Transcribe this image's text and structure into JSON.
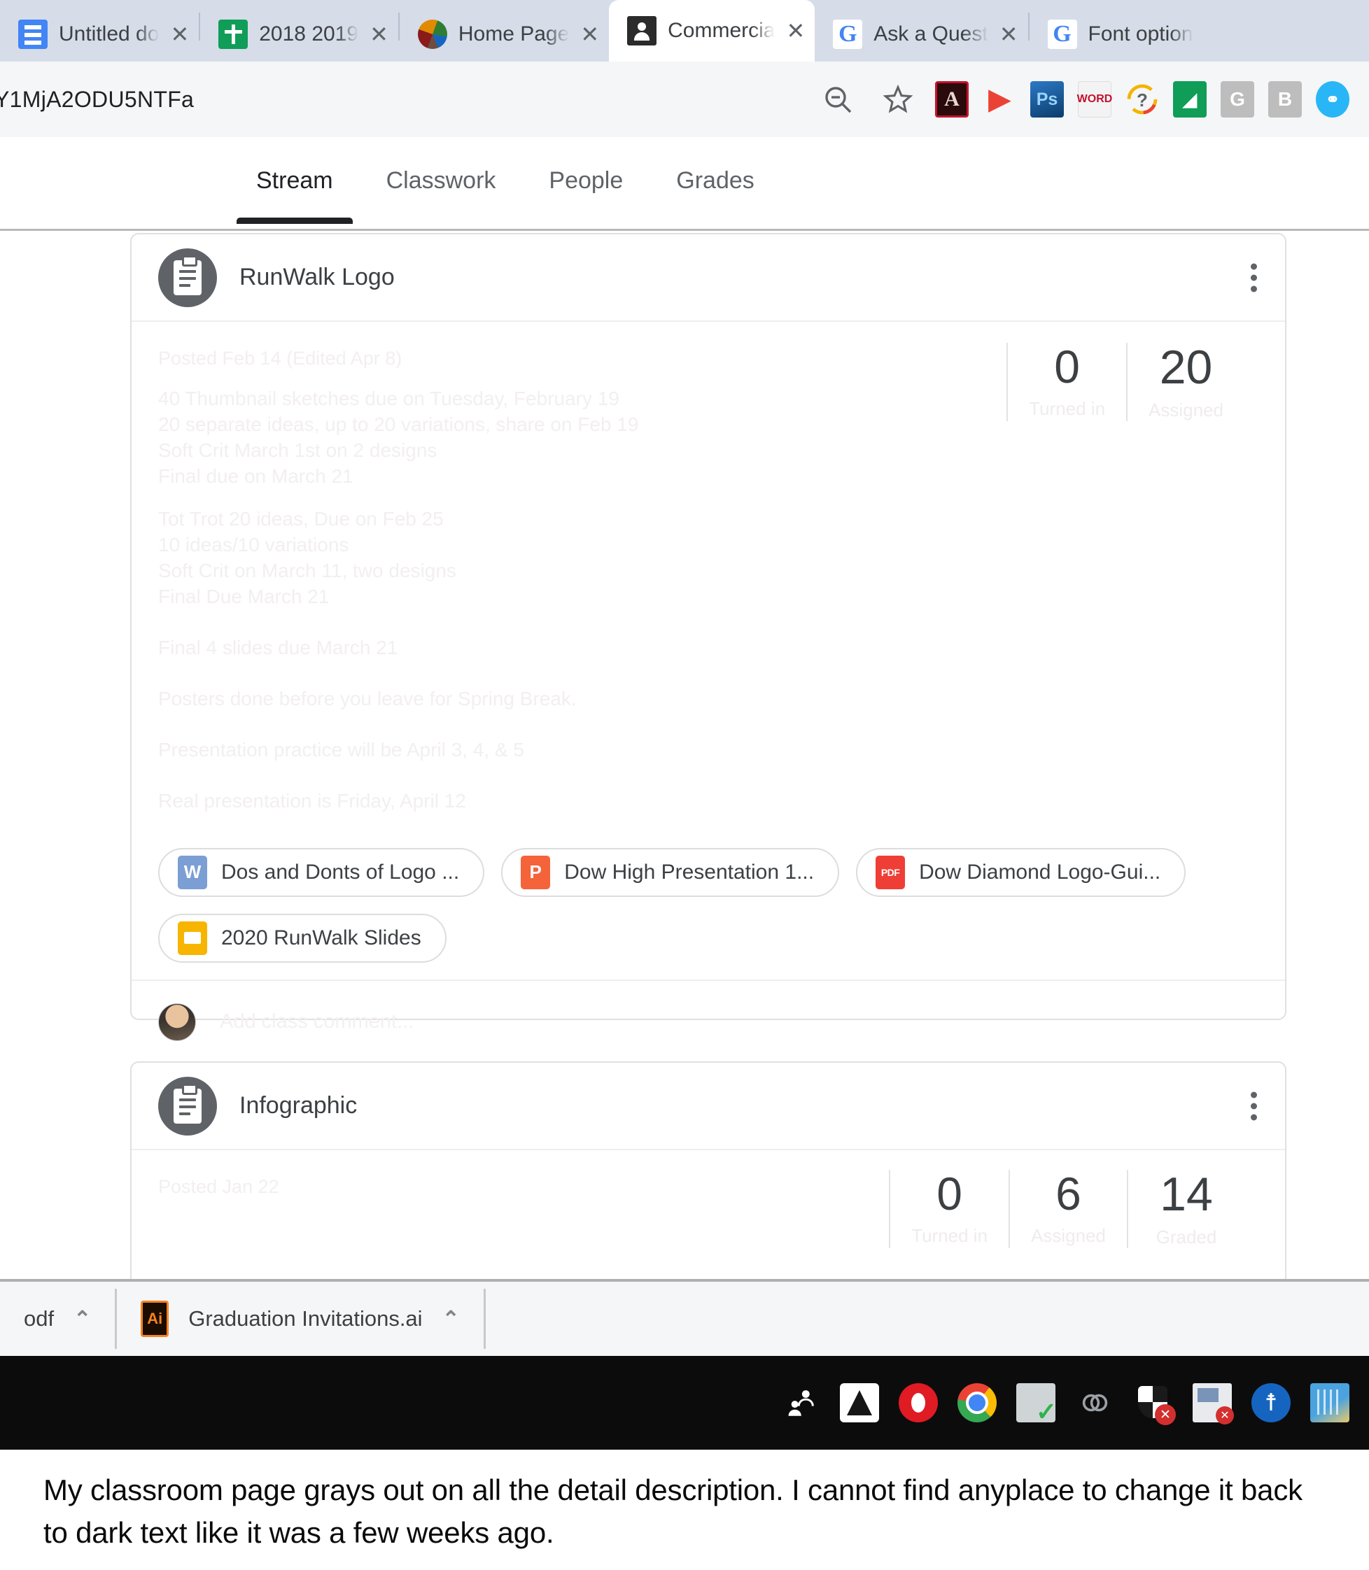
{
  "browser": {
    "tabs": [
      {
        "title": "Untitled do",
        "icon": "google-docs-icon",
        "active": false,
        "close_label": "✕"
      },
      {
        "title": "2018 2019 ",
        "icon": "google-sheets-icon",
        "active": false,
        "close_label": "✕"
      },
      {
        "title": "Home Page",
        "icon": "colored-ball-icon",
        "active": false,
        "close_label": "✕"
      },
      {
        "title": "Commercia",
        "icon": "google-classroom-icon",
        "active": true,
        "close_label": "✕"
      },
      {
        "title": "Ask a Quest",
        "icon": "google-icon",
        "active": false,
        "close_label": "✕"
      },
      {
        "title": "Font option",
        "icon": "google-icon",
        "active": false,
        "close_label": ""
      }
    ],
    "omnibox": {
      "url": "Y1MjA2ODU5NTFa",
      "zoom_out_icon": "zoom-out-icon",
      "bookmark_icon": "star-icon"
    },
    "extensions": [
      {
        "name": "adobe-acrobat-extension-icon",
        "glyph": ""
      },
      {
        "name": "red-arrow-extension-icon",
        "glyph": "▶"
      },
      {
        "name": "photoshop-extension-icon",
        "glyph": "Ps"
      },
      {
        "name": "word-converter-extension-icon",
        "glyph": "WORD"
      },
      {
        "name": "question-mark-extension-icon",
        "glyph": "?"
      },
      {
        "name": "green-feed-extension-icon",
        "glyph": "◢"
      },
      {
        "name": "grammarly-extension-icon",
        "glyph": "G"
      },
      {
        "name": "b-extension-icon",
        "glyph": "B"
      },
      {
        "name": "link-extension-icon",
        "glyph": "⚭"
      }
    ]
  },
  "classroom": {
    "nav_tabs": [
      {
        "label": "Stream",
        "active": true
      },
      {
        "label": "Classwork",
        "active": false
      },
      {
        "label": "People",
        "active": false
      },
      {
        "label": "Grades",
        "active": false
      }
    ],
    "posts": [
      {
        "title": "RunWalk Logo",
        "icon": "assignment-clipboard-icon",
        "menu_icon": "more-options-icon",
        "posted": "Posted Feb 14 (Edited Apr 8)",
        "description_block_1": "40 Thumbnail sketches due on Tuesday, February 19\n20 separate ideas, up to 20 variations, share on Feb 19\nSoft  Crit March 1st on 2 designs\nFinal due on March 21",
        "description_block_2": "Tot  Trot 20 ideas, Due on Feb 25\n10 ideas/10 variations\nSoft Crit on March 11, two designs\nFinal Due March 21",
        "description_line_1": "Final 4 slides due March 21",
        "description_line_2": "Posters done before you leave for Spring Break.",
        "description_line_3": "Presentation practice will be April 3, 4, & 5",
        "description_line_4": "Real presentation is Friday, April 12",
        "stats": [
          {
            "value": "0",
            "label": "Turned in"
          },
          {
            "value": "20",
            "label": "Assigned"
          }
        ],
        "attachments": [
          {
            "label": "Dos and Donts of Logo ...",
            "type": "word",
            "glyph": "W"
          },
          {
            "label": "Dow High Presentation 1...",
            "type": "powerpoint",
            "glyph": "P"
          },
          {
            "label": "Dow Diamond Logo-Gui...",
            "type": "pdf",
            "glyph": "PDF"
          },
          {
            "label": "2020 RunWalk Slides",
            "type": "slides",
            "glyph": ""
          }
        ],
        "comment_placeholder": "Add class comment..."
      },
      {
        "title": "Infographic",
        "icon": "assignment-clipboard-icon",
        "menu_icon": "more-options-icon",
        "posted": "Posted Jan 22",
        "stats": [
          {
            "value": "0",
            "label": "Turned in"
          },
          {
            "value": "6",
            "label": "Assigned"
          },
          {
            "value": "14",
            "label": "Graded"
          }
        ]
      }
    ]
  },
  "download_shelf": {
    "items": [
      {
        "name": "odf",
        "icon": "",
        "caret": "⌃"
      },
      {
        "name": "Graduation Invitations.ai",
        "icon": "illustrator-file-icon",
        "caret": "⌃"
      }
    ]
  },
  "taskbar": {
    "icons": [
      "people-icon",
      "google-drive-icon",
      "opera-icon",
      "google-chrome-icon",
      "printer-ready-icon",
      "creative-cloud-icon",
      "security-shield-error-icon",
      "files-error-icon",
      "bluetooth-icon",
      "maps-icon"
    ]
  },
  "caption": {
    "text": "My classroom page grays out on all the detail description. I cannot find anyplace to change it back to dark text like it was a few weeks ago."
  }
}
